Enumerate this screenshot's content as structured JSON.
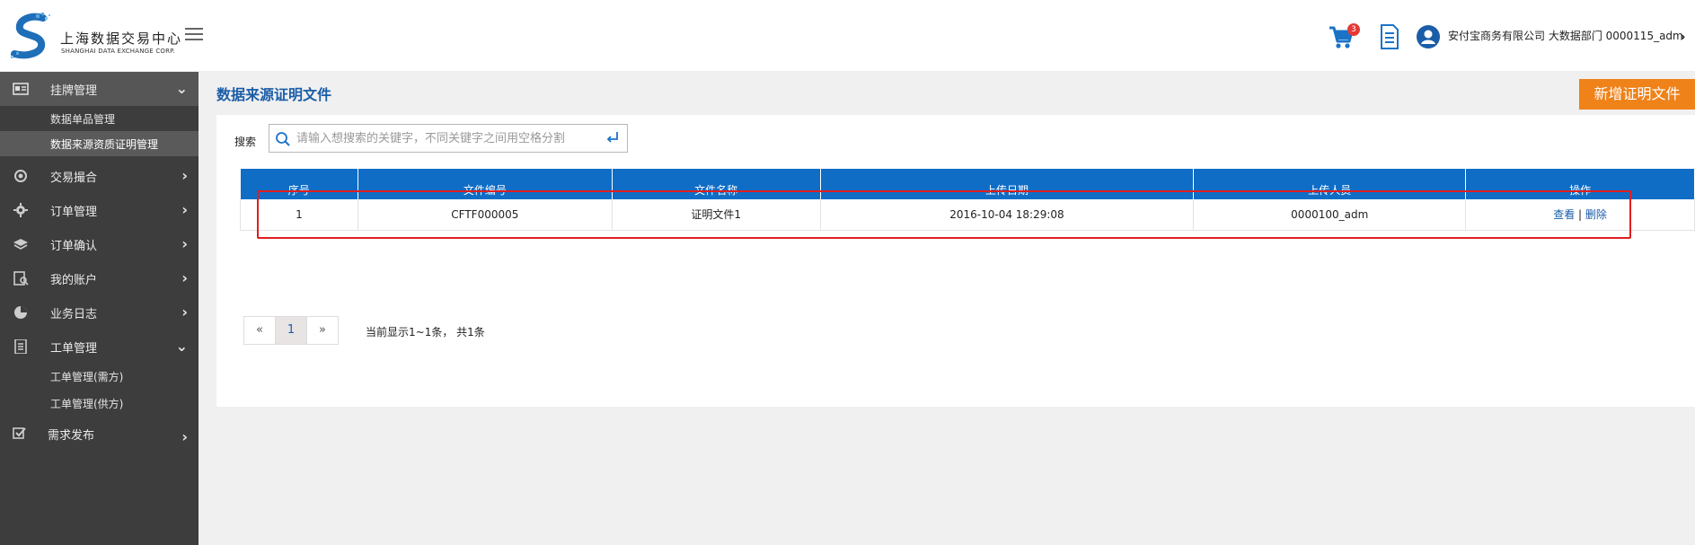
{
  "header": {
    "logo_cn": "上海数据交易中心",
    "logo_en": "SHANGHAI DATA EXCHANGE CORP.",
    "cart_count": "3",
    "user_info": "安付宝商务有限公司 大数据部门 0000115_adm",
    "user_arrow": "›"
  },
  "sidebar": {
    "items": [
      {
        "label": "挂牌管理",
        "icon": "id-card-icon",
        "arrow": "⌄"
      },
      {
        "label": "交易撮合",
        "icon": "gear-cluster-icon",
        "arrow": "›"
      },
      {
        "label": "订单管理",
        "icon": "gear-icon",
        "arrow": "›"
      },
      {
        "label": "订单确认",
        "icon": "layers-icon",
        "arrow": "›"
      },
      {
        "label": "我的账户",
        "icon": "account-icon",
        "arrow": "›"
      },
      {
        "label": "业务日志",
        "icon": "pie-icon",
        "arrow": "›"
      },
      {
        "label": "工单管理",
        "icon": "document-icon",
        "arrow": "⌄"
      },
      {
        "label": "需求发布",
        "icon": "checkbox-icon",
        "arrow": "›"
      }
    ],
    "sub_listing": [
      "数据单品管理",
      "数据来源资质证明管理"
    ],
    "sub_ticket": [
      "工单管理(需方)",
      "工单管理(供方)"
    ]
  },
  "main": {
    "title": "数据来源证明文件",
    "add_button": "新增证明文件",
    "search": {
      "label": "搜索",
      "placeholder": "请输入想搜索的关键字，不同关键字之间用空格分割"
    },
    "table": {
      "headers": [
        "序号",
        "文件编号",
        "文件名称",
        "上传日期",
        "上传人员",
        "操作"
      ],
      "rows": [
        {
          "no": "1",
          "file_id": "CFTF000005",
          "file_name": "证明文件1",
          "date": "2016-10-04 18:29:08",
          "uploader": "0000100_adm",
          "view": "查看",
          "sep": "|",
          "delete": "删除"
        }
      ]
    },
    "pager": {
      "prev": "«",
      "current": "1",
      "next": "»",
      "info": "当前显示1~1条，  共1条"
    }
  },
  "colors": {
    "accent_blue": "#0f6dc6",
    "title_blue": "#1a5da8",
    "orange": "#ef8219",
    "sidebar_bg": "#3d3d3d",
    "highlight_red": "#e01e1e"
  }
}
